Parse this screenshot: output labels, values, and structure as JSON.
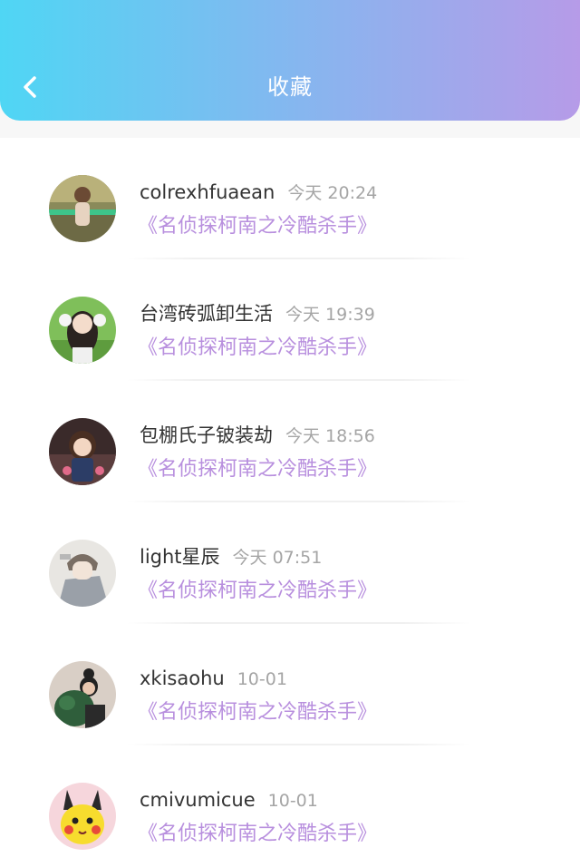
{
  "header": {
    "title": "收藏",
    "back_icon": "chevron-left-icon"
  },
  "favorites": [
    {
      "user": "colrexhfuaean",
      "time": "今天 20:24",
      "title": "《名侦探柯南之冷酷杀手》"
    },
    {
      "user": "台湾砖弧卸生活",
      "time": "今天 19:39",
      "title": "《名侦探柯南之冷酷杀手》"
    },
    {
      "user": "包棚氏子铍装劫",
      "time": "今天 18:56",
      "title": "《名侦探柯南之冷酷杀手》"
    },
    {
      "user": "light星辰",
      "time": "今天 07:51",
      "title": "《名侦探柯南之冷酷杀手》"
    },
    {
      "user": "xkisaohu",
      "time": "10-01",
      "title": "《名侦探柯南之冷酷杀手》"
    },
    {
      "user": "cmivumicue",
      "time": "10-01",
      "title": "《名侦探柯南之冷酷杀手》"
    }
  ],
  "colors": {
    "header_gradient_start": "#4fd6f4",
    "header_gradient_end": "#b69be8",
    "title_link": "#b88fde",
    "username": "#333333",
    "timestamp": "#a5a5a5"
  }
}
